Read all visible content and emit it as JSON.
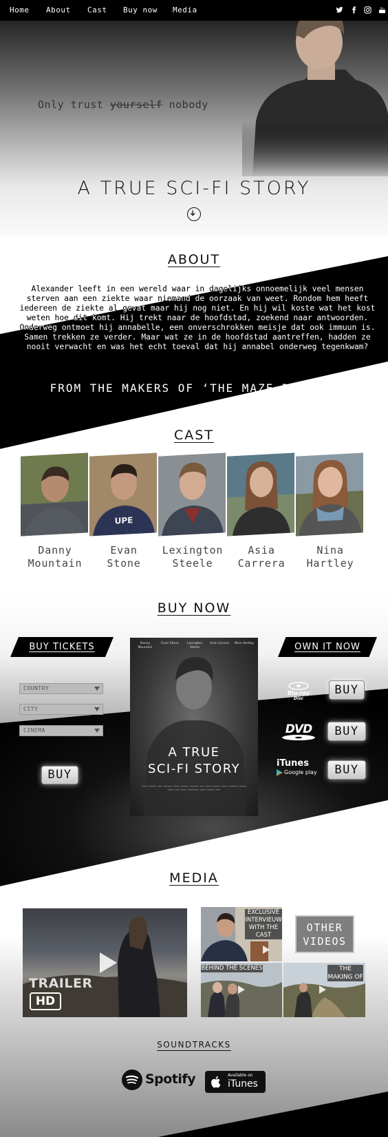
{
  "nav": {
    "items": [
      "Home",
      "About",
      "Cast",
      "Buy now",
      "Media"
    ],
    "social_icons": [
      "twitter-icon",
      "facebook-icon",
      "instagram-icon",
      "youtube-icon"
    ]
  },
  "hero": {
    "tagline_before": "Only trust ",
    "tagline_struck": "yourself",
    "tagline_after": " nobody",
    "title": "A TRUE SCI-FI STORY"
  },
  "about": {
    "title": "ABOUT",
    "text": "Alexander leeft in een wereld waar in dagelijks onnoemelijk veel mensen sterven aan een ziekte waar niemand de oorzaak van weet. Rondom hem heeft iedereen de ziekte al gevat maar hij nog niet. En hij wil koste wat het kost weten hoe dit komt. Hij trekt naar de hoofdstad, zoekend naar antwoorden. Onderweg ontmoet hij annabelle, een onverschrokken meisje dat ook immuun is. Samen trekken ze verder. Maar wat ze in de hoofdstad aantreffen, hadden ze nooit verwacht en was het echt toeval dat hij annabel onderweg tegenkwam?",
    "makers": "FROM THE MAKERS OF ‘THE MAZE RUNNER’"
  },
  "cast": {
    "title": "CAST",
    "members": [
      {
        "first": "Danny",
        "last": "Mountain"
      },
      {
        "first": "Evan",
        "last": "Stone"
      },
      {
        "first": "Lexington",
        "last": "Steele"
      },
      {
        "first": "Asia",
        "last": "Carrera"
      },
      {
        "first": "Nina",
        "last": "Hartley"
      }
    ]
  },
  "buy": {
    "title": "BUY NOW",
    "tickets_banner": "BUY TICKETS",
    "own_banner": "OWN IT NOW",
    "selects": [
      "COUNTRY",
      "CITY",
      "CINEMA"
    ],
    "buy_label": "BUY",
    "poster": {
      "cast": [
        "Danny Mountain",
        "Evan Stone",
        "Lexington Steele",
        "Asia Carrera",
        "Nina Hartley"
      ],
      "title_line1": "A TRUE",
      "title_line2": "SCI-FI STORY"
    },
    "formats": {
      "bluray_top": "Blu-ray",
      "bluray_bottom": "Disc",
      "dvd": "DVD",
      "itunes": "iTunes",
      "google": "Google play"
    }
  },
  "media": {
    "title": "MEDIA",
    "trailer_label": "TRAILER",
    "trailer_badge": "HD",
    "thumbs": [
      {
        "label": "EXCLUSIVE INTERVIEUW WITH THE CAST"
      },
      {
        "label": "BEHIND THE SCENES"
      },
      {
        "label": "THE MAKING OF"
      }
    ],
    "other_videos_line1": "OTHER",
    "other_videos_line2": "VIDEOS",
    "soundtracks_title": "SOUNDTRACKS",
    "spotify": "Spotify",
    "itunes_small": "Available on",
    "itunes_big": "iTunes"
  }
}
